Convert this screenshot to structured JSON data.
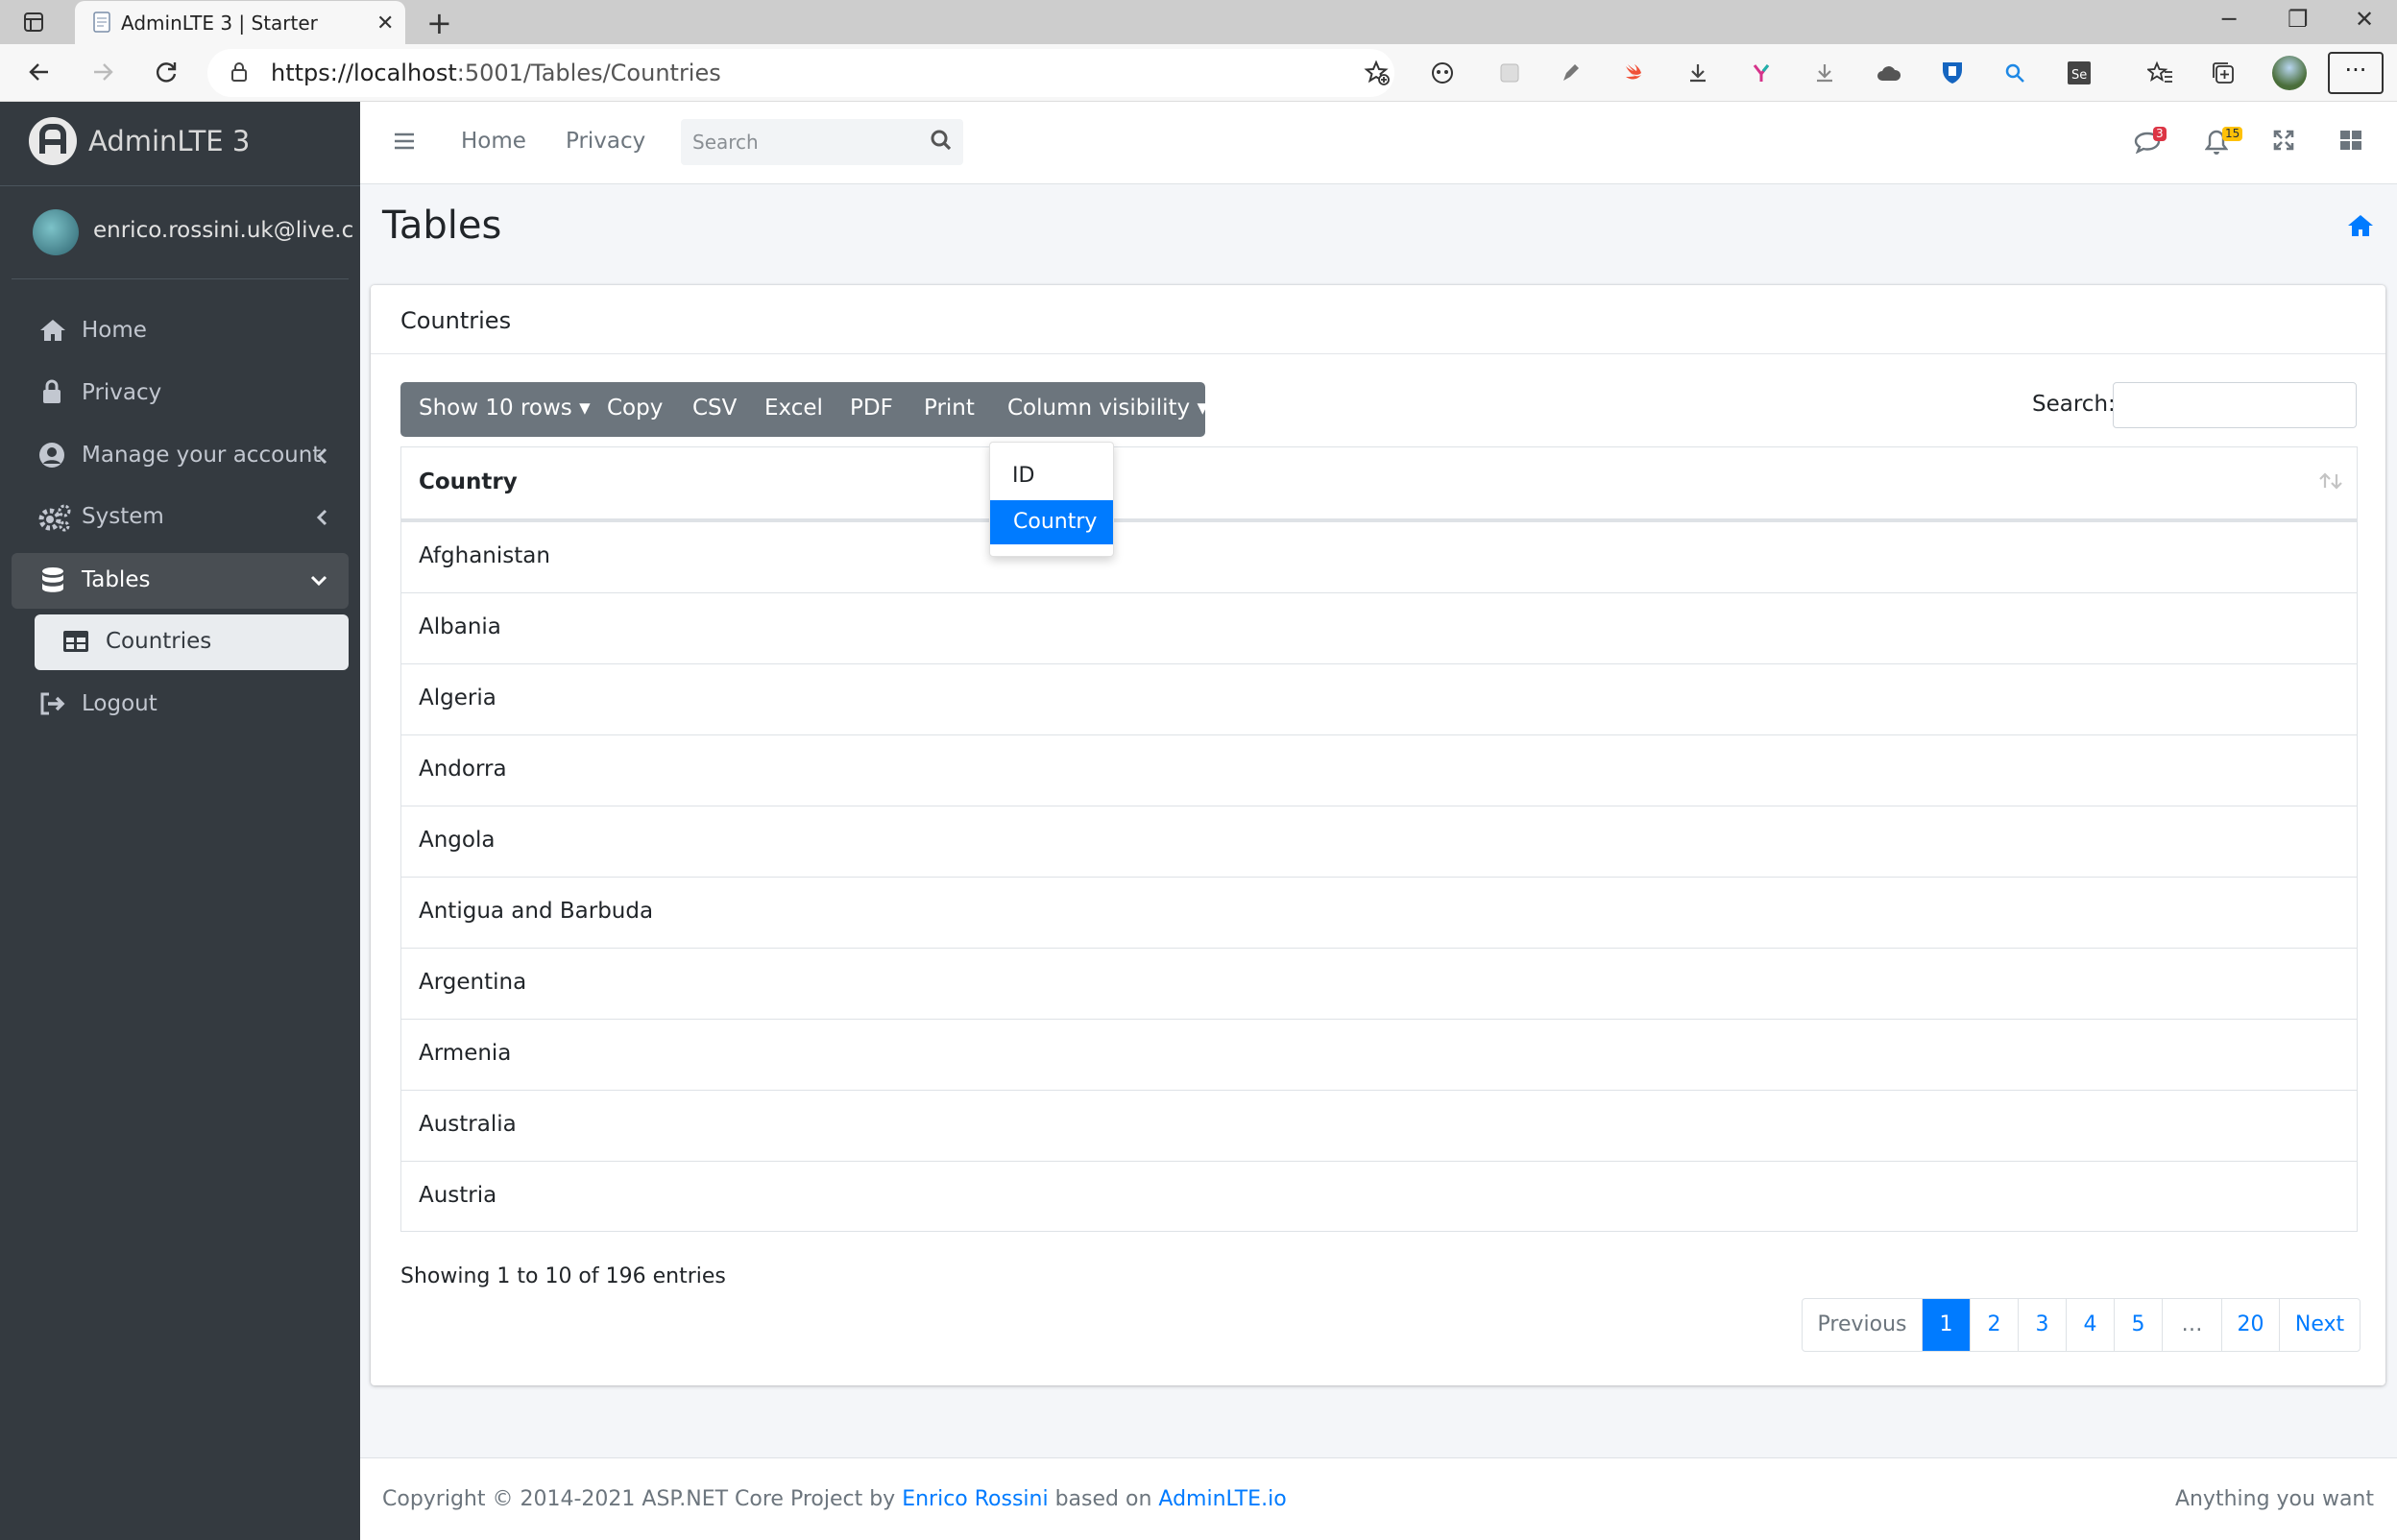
{
  "browser": {
    "tab_title": "AdminLTE 3 | Starter",
    "url_host": "https://localhost",
    "url_rest": ":5001/Tables/Countries"
  },
  "brand": {
    "name": "AdminLTE 3"
  },
  "user": {
    "email": "enrico.rossini.uk@live.com"
  },
  "sidebar": {
    "items": [
      {
        "label": "Home",
        "icon": "home-icon"
      },
      {
        "label": "Privacy",
        "icon": "lock-icon"
      },
      {
        "label": "Manage your account",
        "icon": "user-circle-icon"
      },
      {
        "label": "System",
        "icon": "cogs-icon"
      },
      {
        "label": "Tables",
        "icon": "database-icon"
      },
      {
        "label": "Countries",
        "icon": "table-icon"
      },
      {
        "label": "Logout",
        "icon": "logout-icon"
      }
    ]
  },
  "navbar": {
    "home": "Home",
    "privacy": "Privacy",
    "search_placeholder": "Search",
    "messages_badge": "3",
    "notifications_badge": "15"
  },
  "page": {
    "title": "Tables"
  },
  "card": {
    "title": "Countries",
    "buttons": {
      "show_rows": "Show 10 rows",
      "copy": "Copy",
      "csv": "CSV",
      "excel": "Excel",
      "pdf": "PDF",
      "print": "Print",
      "column_visibility": "Column visibility"
    },
    "search_label": "Search:",
    "column_header": "Country",
    "rows": [
      "Afghanistan",
      "Albania",
      "Algeria",
      "Andorra",
      "Angola",
      "Antigua and Barbuda",
      "Argentina",
      "Armenia",
      "Australia",
      "Austria"
    ],
    "info": "Showing 1 to 10 of 196 entries",
    "pagination": [
      "Previous",
      "1",
      "2",
      "3",
      "4",
      "5",
      "…",
      "20",
      "Next"
    ],
    "active_page": "1"
  },
  "dropdown": {
    "items": [
      "ID",
      "Country"
    ],
    "selected": "Country"
  },
  "footer": {
    "copyright_prefix": "Copyright © 2014-2021 ASP.NET Core Project by",
    "author": "Enrico Rossini",
    "based_on": "based on",
    "adminlte": "AdminLTE.io",
    "right": "Anything you want"
  },
  "colors": {
    "accent": "#007bff",
    "sidebar": "#343a40",
    "button_group": "#6c757d"
  }
}
